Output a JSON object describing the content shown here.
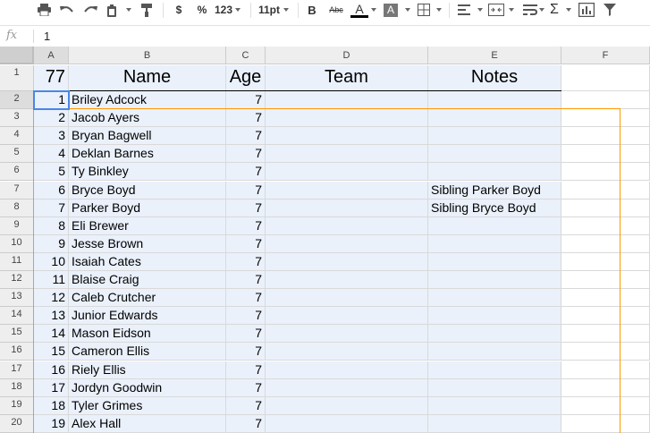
{
  "toolbar": {
    "icons": [
      "print-icon",
      "undo-icon",
      "redo-icon",
      "paint-format-icon",
      "paint-roller-icon",
      "currency-icon",
      "percent-icon",
      "more-formats-icon",
      "font-size",
      "bold-icon",
      "strikethrough-icon",
      "text-color-icon",
      "fill-color-icon",
      "borders-icon",
      "align-icon",
      "merge-icon",
      "wrap-icon",
      "functions-icon",
      "chart-icon",
      "filter-icon"
    ],
    "currency_label": "$",
    "percent_label": "%",
    "more_formats_label": "123",
    "font_size": "11pt",
    "bold_label": "B",
    "strike_label": "Abc",
    "text_color_label": "A",
    "text_color": "#000000",
    "fill_color_label": "A",
    "functions_label": "Σ"
  },
  "formula_bar": {
    "fx_label": "fx",
    "value": "1"
  },
  "columns": [
    "A",
    "B",
    "C",
    "D",
    "E",
    "F"
  ],
  "header_row": {
    "a": "77",
    "b": "Name",
    "c": "Age",
    "d": "Team",
    "e": "Notes"
  },
  "rows": [
    {
      "row": "2",
      "num": "1",
      "name": "Briley Adcock",
      "age": "7",
      "notes": ""
    },
    {
      "row": "3",
      "num": "2",
      "name": "Jacob Ayers",
      "age": "7",
      "notes": ""
    },
    {
      "row": "4",
      "num": "3",
      "name": "Bryan Bagwell",
      "age": "7",
      "notes": ""
    },
    {
      "row": "5",
      "num": "4",
      "name": "Deklan Barnes",
      "age": "7",
      "notes": ""
    },
    {
      "row": "6",
      "num": "5",
      "name": "Ty Binkley",
      "age": "7",
      "notes": ""
    },
    {
      "row": "7",
      "num": "6",
      "name": "Bryce Boyd",
      "age": "7",
      "notes": "Sibling Parker Boyd"
    },
    {
      "row": "8",
      "num": "7",
      "name": "Parker Boyd",
      "age": "7",
      "notes": "Sibling Bryce Boyd"
    },
    {
      "row": "9",
      "num": "8",
      "name": "Eli Brewer",
      "age": "7",
      "notes": ""
    },
    {
      "row": "10",
      "num": "9",
      "name": "Jesse Brown",
      "age": "7",
      "notes": ""
    },
    {
      "row": "11",
      "num": "10",
      "name": "Isaiah Cates",
      "age": "7",
      "notes": ""
    },
    {
      "row": "12",
      "num": "11",
      "name": "Blaise Craig",
      "age": "7",
      "notes": ""
    },
    {
      "row": "13",
      "num": "12",
      "name": "Caleb Crutcher",
      "age": "7",
      "notes": ""
    },
    {
      "row": "14",
      "num": "13",
      "name": "Junior Edwards",
      "age": "7",
      "notes": ""
    },
    {
      "row": "15",
      "num": "14",
      "name": "Mason Eidson",
      "age": "7",
      "notes": ""
    },
    {
      "row": "16",
      "num": "15",
      "name": "Cameron Ellis",
      "age": "7",
      "notes": ""
    },
    {
      "row": "17",
      "num": "16",
      "name": "Riely Ellis",
      "age": "7",
      "notes": ""
    },
    {
      "row": "18",
      "num": "17",
      "name": "Jordyn Goodwin",
      "age": "7",
      "notes": ""
    },
    {
      "row": "19",
      "num": "18",
      "name": "Tyler Grimes",
      "age": "7",
      "notes": ""
    },
    {
      "row": "20",
      "num": "19",
      "name": "Alex Hall",
      "age": "7",
      "notes": ""
    }
  ],
  "first_row_label": "1",
  "colors": {
    "selection": "#4a86e8",
    "range_outline": "#ff9900",
    "banded_fill": "#eaf1fb"
  }
}
